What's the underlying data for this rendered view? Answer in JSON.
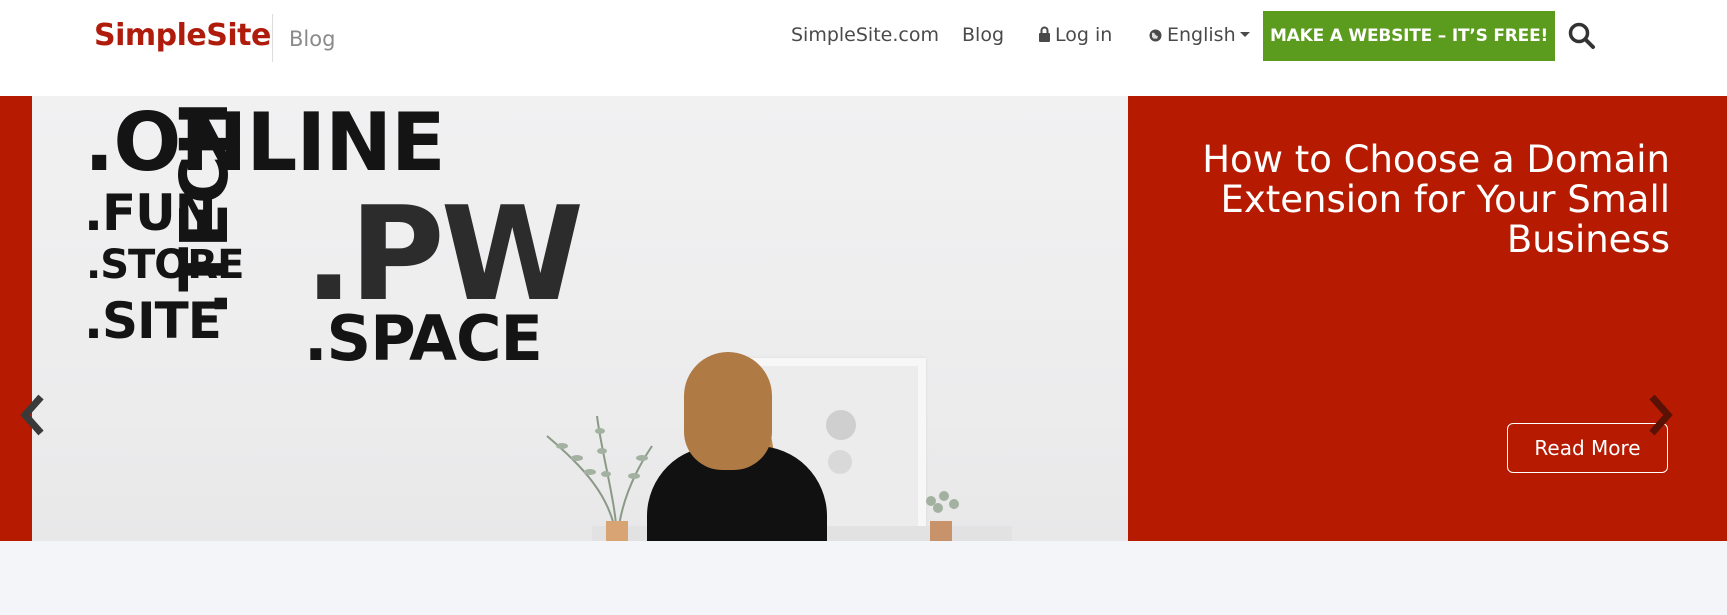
{
  "header": {
    "logo_text": "SimpleSite",
    "section_label": "Blog",
    "nav": {
      "simplesite": "SimpleSite.com",
      "blog": "Blog",
      "login": "Log in",
      "language": "English"
    },
    "cta_label": "MAKE A WEBSITE – IT’S FREE!",
    "icons": [
      "lock-icon",
      "globe-icon",
      "caret-down-icon",
      "search-icon"
    ],
    "colors": {
      "brand": "#b01c0c",
      "cta": "#5b9b1d",
      "text": "#4a4a4a"
    }
  },
  "hero": {
    "image_words": {
      "online": ".ONLINE",
      "fun": ".FUN",
      "store": ".STORE",
      "site": ".SITE",
      "tech": ".TECH",
      "pw": ".PW",
      "space": ".SPACE"
    },
    "title": "How to Choose a Domain Extension for Your Small Business",
    "read_more_label": "Read More",
    "icons": [
      "chevron-left-icon",
      "chevron-right-icon"
    ],
    "colors": {
      "panel": "#b61a01",
      "panel_text": "#ffffff"
    }
  }
}
